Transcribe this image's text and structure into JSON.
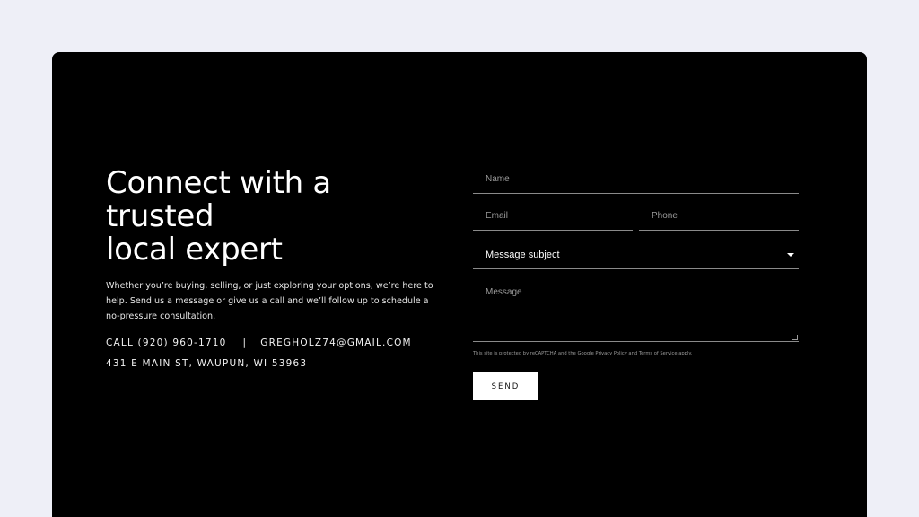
{
  "hero": {
    "headline_line1": "Connect with a trusted",
    "headline_line2": "local expert",
    "intro": "Whether you’re buying, selling, or just exploring your options, we’re here to help. Send us a message or give us a call and we’ll follow up to schedule a no-pressure consultation.",
    "phone": "CALL (920) 960-1710",
    "separator": "|",
    "email": "GREGHOLZ74@GMAIL.COM",
    "address": "431 E MAIN ST, WAUPUN, WI 53963"
  },
  "form": {
    "name_placeholder": "Name",
    "email_placeholder": "Email",
    "phone_placeholder": "Phone",
    "subject_selected": "Message subject",
    "message_placeholder": "Message",
    "legal": "This site is protected by reCAPTCHA and the Google Privacy Policy and Terms of Service apply.",
    "send_label": "SEND"
  },
  "colors": {
    "page_background": "#eeeff7",
    "card_background": "#000000",
    "button_background": "#ffffff"
  }
}
